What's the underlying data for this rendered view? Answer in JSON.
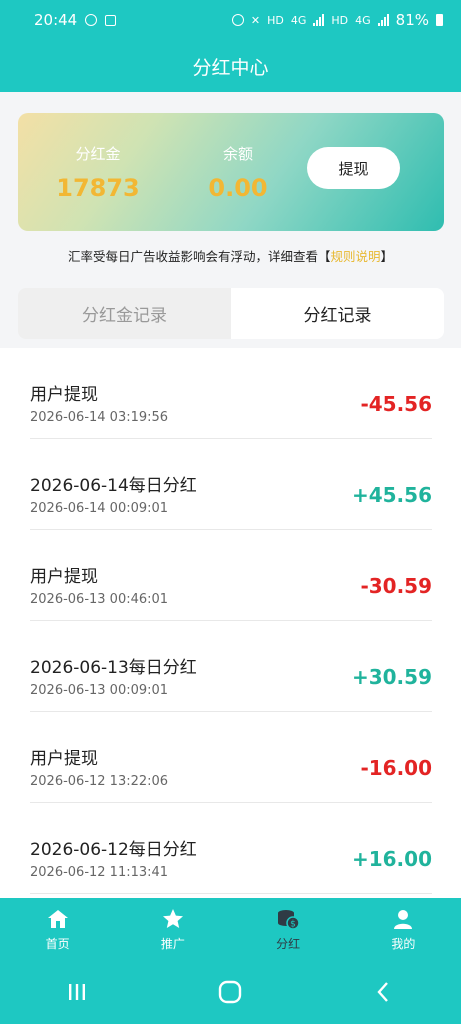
{
  "status_bar": {
    "time": "20:44",
    "network_a": "HD",
    "network_b": "4G",
    "network_c": "HD",
    "network_d": "4G",
    "battery": "81%"
  },
  "header": {
    "title": "分红中心"
  },
  "balance_card": {
    "dividend_label": "分红金",
    "dividend_value": "17873",
    "balance_label": "余额",
    "balance_value": "0.00",
    "withdraw_button": "提现"
  },
  "notice": {
    "text_before": "汇率受每日广告收益影响会有浮动，详细查看【",
    "link": "规则说明",
    "text_after": "】"
  },
  "tabs": [
    {
      "label": "分红金记录",
      "active": false
    },
    {
      "label": "分红记录",
      "active": true
    }
  ],
  "records": [
    {
      "title": "用户提现",
      "date": "2026-06-14 03:19:56",
      "amount": "-45.56"
    },
    {
      "title": "2026-06-14每日分红",
      "date": "2026-06-14 00:09:01",
      "amount": "+45.56"
    },
    {
      "title": "用户提现",
      "date": "2026-06-13 00:46:01",
      "amount": "-30.59"
    },
    {
      "title": "2026-06-13每日分红",
      "date": "2026-06-13 00:09:01",
      "amount": "+30.59"
    },
    {
      "title": "用户提现",
      "date": "2026-06-12 13:22:06",
      "amount": "-16.00"
    },
    {
      "title": "2026-06-12每日分红",
      "date": "2026-06-12 11:13:41",
      "amount": "+16.00"
    }
  ],
  "bottom_nav": [
    {
      "label": "首页",
      "icon": "home-icon"
    },
    {
      "label": "推广",
      "icon": "star-icon"
    },
    {
      "label": "分红",
      "icon": "coins-icon",
      "active": true
    },
    {
      "label": "我的",
      "icon": "user-icon"
    }
  ],
  "colors": {
    "brand": "#1ec8c2",
    "negative": "#e32424",
    "positive": "#20b39c",
    "highlight": "#f2b734"
  }
}
